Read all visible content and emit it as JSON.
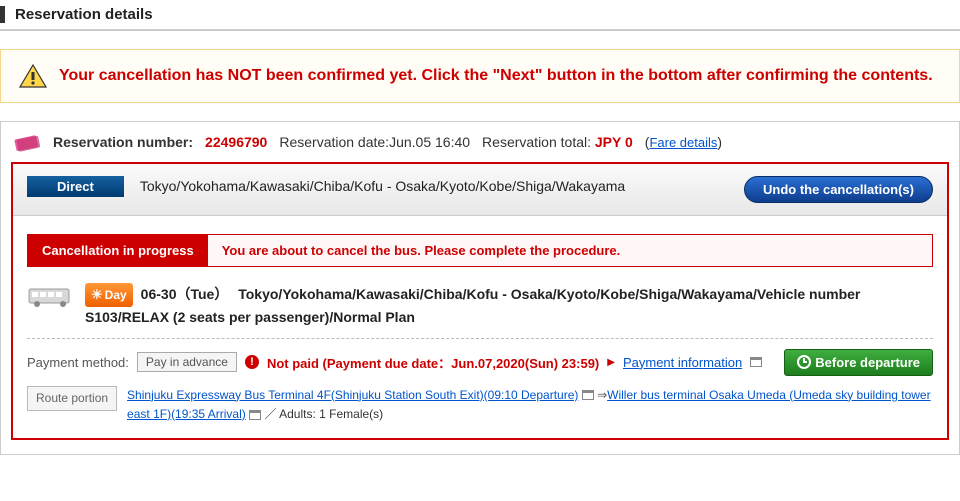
{
  "page_title": "Reservation details",
  "warning": {
    "text": "Your cancellation has NOT been confirmed yet. Click the \"Next\" button in the bottom after confirming the contents."
  },
  "reservation": {
    "num_label": "Reservation number:",
    "num_value": "22496790",
    "date_label": "Reservation date:",
    "date_value": "Jun.05 16:40",
    "total_label": "Reservation total:",
    "total_value": "JPY 0",
    "fare_link": "Fare details"
  },
  "route": {
    "direct_badge": "Direct",
    "route_text": "Tokyo/Yokohama/Kawasaki/Chiba/Kofu - Osaka/Kyoto/Kobe/Shiga/Wakayama",
    "undo_button": "Undo the cancellation(s)"
  },
  "cancel_bar": {
    "label": "Cancellation in progress",
    "text": "You are about to cancel the bus. Please complete the procedure."
  },
  "trip": {
    "day_badge": "Day",
    "date": "06-30（Tue）",
    "description": "Tokyo/Yokohama/Kawasaki/Chiba/Kofu - Osaka/Kyoto/Kobe/Shiga/Wakayama/Vehicle number S103/RELAX (2 seats per passenger)/Normal Plan"
  },
  "payment": {
    "method_label": "Payment method:",
    "method_value": "Pay in advance",
    "not_paid_text": "Not paid (Payment due date：Jun.07,2020(Sun) 23:59)",
    "info_link": "Payment information",
    "before_departure": "Before departure"
  },
  "route_portion": {
    "label": "Route portion",
    "link1": "Shinjuku Expressway Bus Terminal 4F(Shinjuku Station South Exit)(09:10 Departure)",
    "link2": "Willer bus terminal Osaka Umeda (Umeda sky building tower east 1F)(19:35 Arrival)",
    "passengers": "Adults: 1 Female(s)"
  }
}
